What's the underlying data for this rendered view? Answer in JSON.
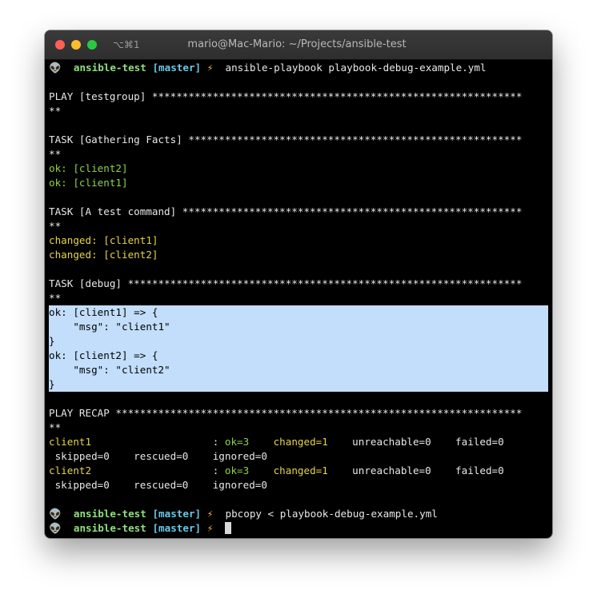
{
  "window": {
    "shortcut": "⌥⌘1",
    "title": "mario@Mac-Mario: ~/Projects/ansible-test"
  },
  "prompt": {
    "icon": "alien-icon",
    "dir": "ansible-test",
    "branch": "[master]",
    "bolt": "⚡"
  },
  "lines": {
    "cmd1": "ansible-playbook playbook-debug-example.yml",
    "play_header": "PLAY [testgroup] *************************************************************",
    "play_header_cont": "**",
    "task1_header": "TASK [Gathering Facts] *******************************************************",
    "task1_header_cont": "**",
    "task1_ok1": "ok: [client2]",
    "task1_ok2": "ok: [client1]",
    "task2_header": "TASK [A test command] ********************************************************",
    "task2_header_cont": "**",
    "task2_changed1": "changed: [client1]",
    "task2_changed2": "changed: [client2]",
    "task3_header": "TASK [debug] *****************************************************************",
    "task3_header_cont": "**",
    "debug1_open": "ok: [client1] => {",
    "debug1_msg": "    \"msg\": \"client1\"",
    "debug1_close": "}",
    "debug2_open": "ok: [client2] => {",
    "debug2_msg": "    \"msg\": \"client2\"",
    "debug2_close": "}",
    "recap_header": "PLAY RECAP *******************************************************************",
    "recap_header_cont": "**",
    "recap1_host": "client1                    ",
    "recap1_sep": ": ",
    "recap1_ok": "ok=3",
    "recap1_gap1": "    ",
    "recap1_changed": "changed=1",
    "recap1_rest": "    unreachable=0    failed=0",
    "recap1_line2": " skipped=0    rescued=0    ignored=0",
    "recap2_host": "client2                    ",
    "recap2_sep": ": ",
    "recap2_ok": "ok=3",
    "recap2_gap1": "    ",
    "recap2_changed": "changed=1",
    "recap2_rest": "    unreachable=0    failed=0",
    "recap2_line2": " skipped=0    rescued=0    ignored=0",
    "cmd2": "pbcopy < playbook-debug-example.yml"
  }
}
